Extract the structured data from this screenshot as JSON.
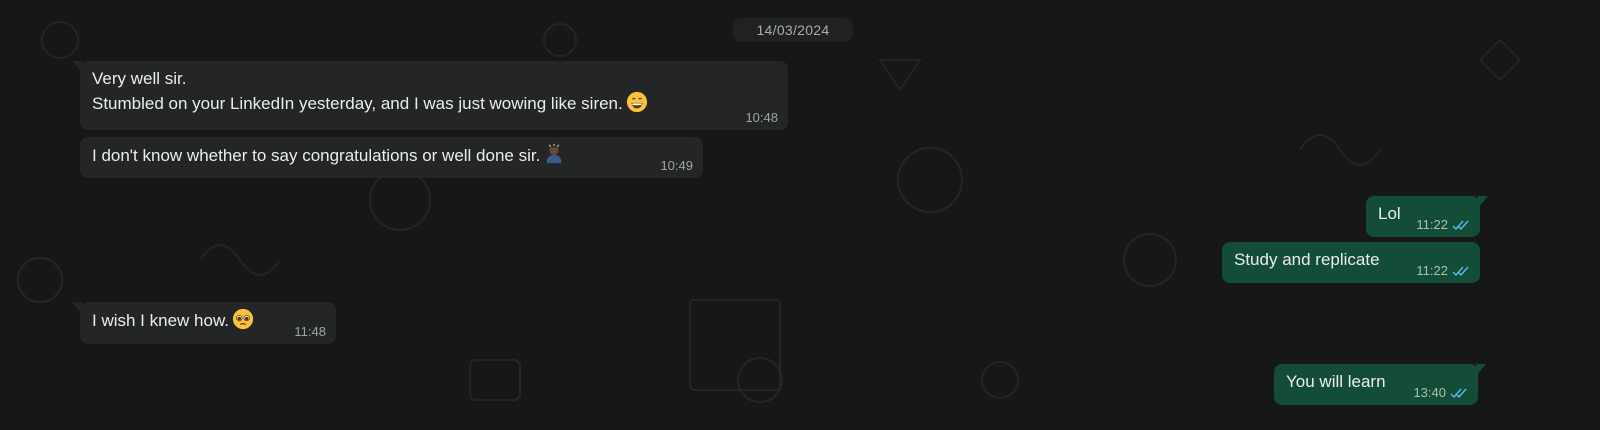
{
  "chat": {
    "date_separator": "14/03/2024",
    "messages": [
      {
        "direction": "incoming",
        "lines": [
          "Very well sir.",
          "Stumbled on your LinkedIn yesterday, and I was just wowing like siren."
        ],
        "emoji": "grinning-face-emoji",
        "time": "10:48"
      },
      {
        "direction": "incoming",
        "lines": [
          "I don't know whether to say congratulations or well done sir."
        ],
        "emoji": "person-bowing-emoji",
        "time": "10:49"
      },
      {
        "direction": "outgoing",
        "lines": [
          "Lol"
        ],
        "time": "11:22",
        "status": "read"
      },
      {
        "direction": "outgoing",
        "lines": [
          "Study and replicate"
        ],
        "time": "11:22",
        "status": "read"
      },
      {
        "direction": "incoming",
        "lines": [
          "I wish I knew how."
        ],
        "emoji": "pleading-face-emoji",
        "time": "11:48"
      },
      {
        "direction": "outgoing",
        "lines": [
          "You will learn"
        ],
        "time": "13:40",
        "status": "read"
      }
    ]
  },
  "colors": {
    "background": "#161717",
    "incoming_bubble": "#242626",
    "outgoing_bubble": "#144d37",
    "read_ticks": "#53bdeb"
  }
}
